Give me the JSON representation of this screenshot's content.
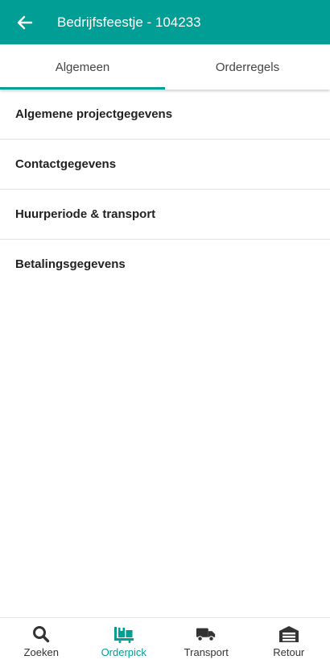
{
  "appbar": {
    "title": "Bedrijfsfeestje - 104233",
    "back_icon": "arrow-left-icon"
  },
  "tabs": [
    {
      "label": "Algemeen",
      "active": true
    },
    {
      "label": "Orderregels",
      "active": false
    }
  ],
  "sections": [
    {
      "label": "Algemene projectgegevens"
    },
    {
      "label": "Contactgegevens"
    },
    {
      "label": "Huurperiode & transport"
    },
    {
      "label": "Betalingsgegevens"
    }
  ],
  "bottom_nav": [
    {
      "label": "Zoeken",
      "icon": "search-icon",
      "active": false
    },
    {
      "label": "Orderpick",
      "icon": "pallet-boxes-icon",
      "active": true
    },
    {
      "label": "Transport",
      "icon": "truck-icon",
      "active": false
    },
    {
      "label": "Retour",
      "icon": "warehouse-icon",
      "active": false
    }
  ],
  "colors": {
    "primary": "#009e95",
    "text": "#222222",
    "divider": "#e0e0e0"
  }
}
